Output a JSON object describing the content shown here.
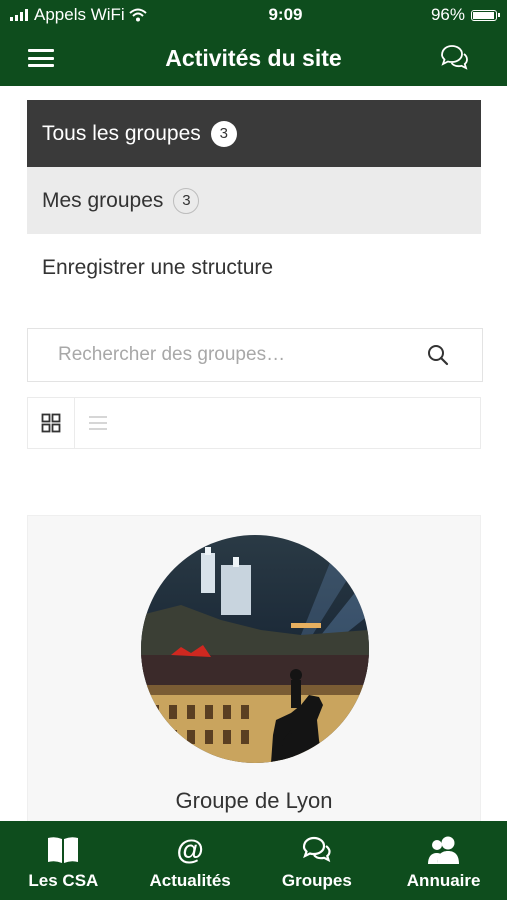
{
  "status_bar": {
    "carrier": "Appels WiFi",
    "time": "9:09",
    "battery": "96%"
  },
  "header": {
    "title": "Activités du site",
    "left_icon": "menu-icon",
    "right_icon": "chat-icon"
  },
  "tabs": [
    {
      "label": "Tous les groupes",
      "count": "3",
      "active": true
    },
    {
      "label": "Mes groupes",
      "count": "3",
      "active": false
    },
    {
      "label": "Enregistrer une structure"
    }
  ],
  "search": {
    "placeholder": "Rechercher des groupes…",
    "value": "",
    "icon": "search-icon"
  },
  "view_toggle": {
    "grid_icon": "grid-icon",
    "list_icon": "list-icon",
    "active": "grid"
  },
  "groups": [
    {
      "name": "Groupe de Lyon"
    }
  ],
  "bottom_nav": [
    {
      "label": "Les CSA",
      "icon": "book-icon"
    },
    {
      "label": "Actualités",
      "icon": "at-icon"
    },
    {
      "label": "Groupes",
      "icon": "chat-icon"
    },
    {
      "label": "Annuaire",
      "icon": "users-icon"
    }
  ],
  "colors": {
    "brand_green": "#0e4d1d",
    "active_tab": "#3a3a3a",
    "secondary_tab": "#ebebeb"
  }
}
